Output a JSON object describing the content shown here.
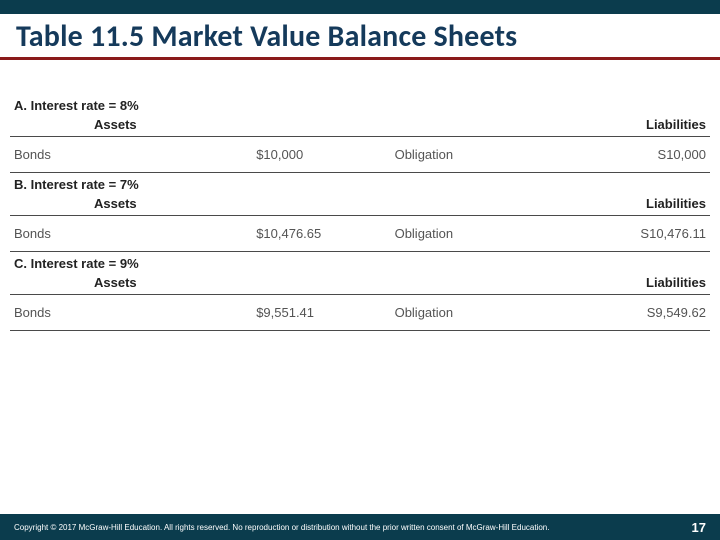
{
  "slide": {
    "title": "Table 11.5 Market Value Balance Sheets"
  },
  "panels": [
    {
      "label": "A. Interest rate = 8%",
      "assets_header": "Assets",
      "liab_header": "Liabilities",
      "asset_name": "Bonds",
      "asset_value": "$10,000",
      "liab_name": "Obligation",
      "liab_value": "S10,000"
    },
    {
      "label": "B. Interest rate = 7%",
      "assets_header": "Assets",
      "liab_header": "Liabilities",
      "asset_name": "Bonds",
      "asset_value": "$10,476.65",
      "liab_name": "Obligation",
      "liab_value": "S10,476.11"
    },
    {
      "label": "C. Interest rate = 9%",
      "assets_header": "Assets",
      "liab_header": "Liabilities",
      "asset_name": "Bonds",
      "asset_value": "$9,551.41",
      "liab_name": "Obligation",
      "liab_value": "S9,549.62"
    }
  ],
  "footer": {
    "copyright": "Copyright © 2017 McGraw-Hill Education. All rights reserved. No reproduction or distribution without the prior written consent of McGraw-Hill Education.",
    "page": "17"
  }
}
